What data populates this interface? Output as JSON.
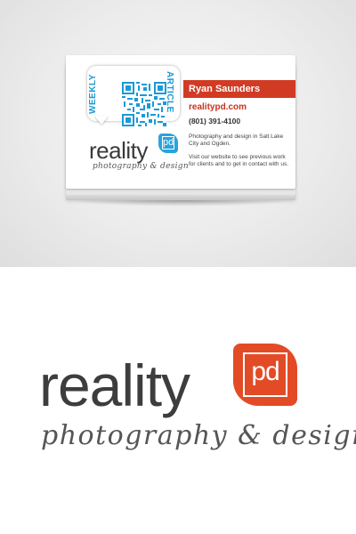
{
  "card": {
    "qr_label_left": "WEEKLY",
    "qr_label_right": "ARTICLE",
    "name": "Ryan Saunders",
    "website": "realitypd.com",
    "phone": "(801) 391-4100",
    "description_1": "Photography and design in Salt Lake City and Ogden.",
    "description_2": "Visit our website to see previous work for clients and to get in contact with us.",
    "logo_word": "reality",
    "logo_mark": "pd",
    "tagline": "photography & design",
    "accent_red": "#d13b23",
    "accent_blue": "#29a3dc"
  },
  "logo": {
    "word": "reality",
    "mark": "pd",
    "tagline": "photography & design",
    "accent_color": "#e34b26"
  }
}
